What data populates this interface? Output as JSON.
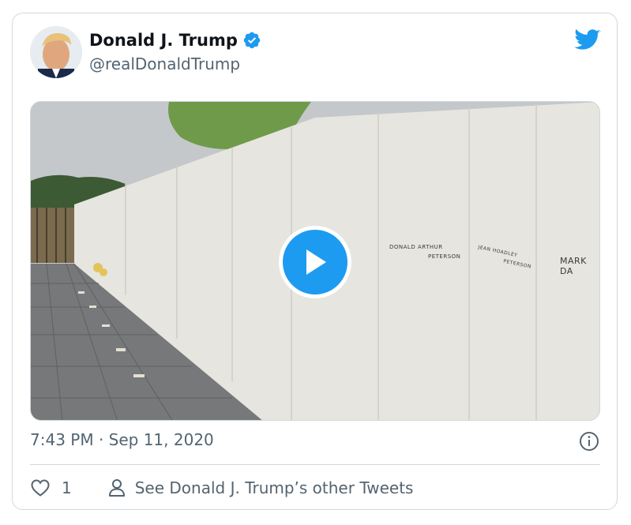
{
  "tweet": {
    "author_name": "Donald J. Trump",
    "author_handle": "@realDonaldTrump",
    "verified": true,
    "timestamp": "7:43 PM · Sep 11, 2020",
    "like_count": "1",
    "other_tweets_label": "See Donald J. Trump’s other Tweets"
  },
  "media": {
    "type": "video",
    "wall_names": [
      "DONALD ARTHUR",
      "PETERSON",
      "JEAN HOADLEY",
      "PETERSON",
      "MARK DA"
    ]
  },
  "icons": {
    "verified": "verified-badge-icon",
    "logo": "twitter-bird-icon",
    "play": "play-icon",
    "info": "info-icon",
    "like": "heart-icon",
    "profile": "person-icon"
  },
  "colors": {
    "accent": "#1d9bf0",
    "secondary_text": "#536471",
    "border": "#cfd9de"
  }
}
